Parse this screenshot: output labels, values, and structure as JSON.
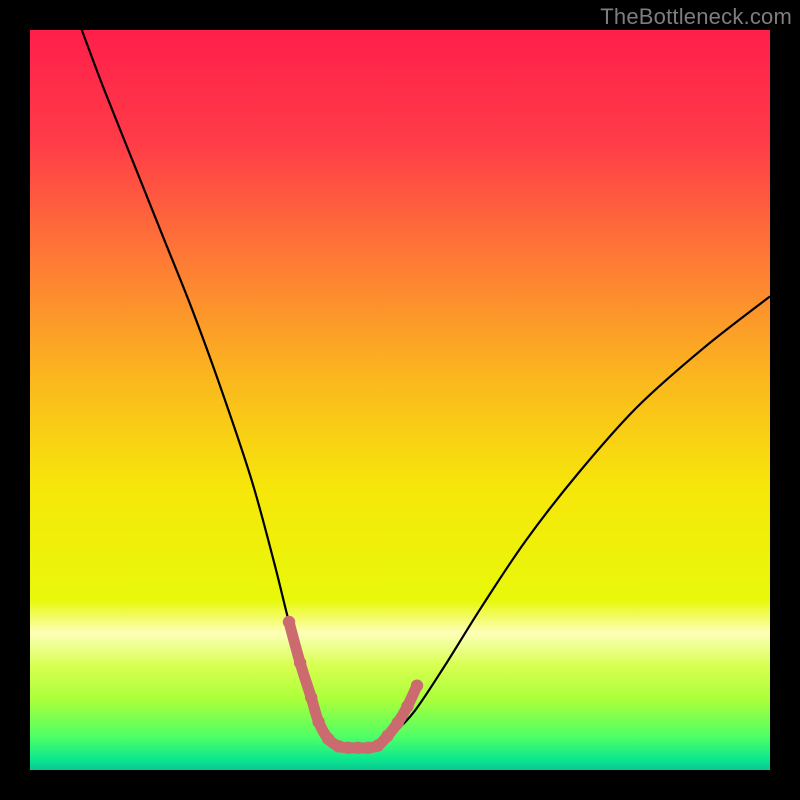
{
  "watermark": "TheBottleneck.com",
  "chart_data": {
    "type": "line",
    "title": "",
    "xlabel": "",
    "ylabel": "",
    "xlim": [
      0,
      100
    ],
    "ylim": [
      0,
      100
    ],
    "grid": false,
    "series": [
      {
        "name": "curve",
        "color": "#000000",
        "x": [
          7,
          10,
          14,
          18,
          22,
          26,
          30,
          33,
          35,
          37,
          38.5,
          40,
          41.5,
          43,
          45,
          47,
          49,
          52,
          56,
          61,
          67,
          74,
          82,
          91,
          100
        ],
        "y": [
          100,
          92,
          82,
          72,
          62,
          51,
          39,
          28,
          20,
          13,
          8,
          4.5,
          3,
          3,
          3,
          3.2,
          4.8,
          8,
          14,
          22,
          31,
          40,
          49,
          57,
          64
        ]
      },
      {
        "name": "highlight-bottom",
        "color": "#cb6a6f",
        "x": [
          35,
          36.5,
          38,
          39,
          40.3,
          41.7,
          43,
          44.3,
          45.7,
          47,
          48.3,
          49.7,
          51,
          52.3
        ],
        "y": [
          20,
          14.5,
          9.8,
          6.5,
          4.2,
          3.2,
          3,
          3,
          3,
          3.3,
          4.6,
          6.4,
          8.6,
          11.4
        ]
      }
    ],
    "background_gradient": {
      "type": "vertical",
      "stops": [
        {
          "offset": 0.0,
          "color": "#ff1f4a"
        },
        {
          "offset": 0.15,
          "color": "#ff3b48"
        },
        {
          "offset": 0.3,
          "color": "#fe7637"
        },
        {
          "offset": 0.47,
          "color": "#fbb71e"
        },
        {
          "offset": 0.62,
          "color": "#f6e70a"
        },
        {
          "offset": 0.77,
          "color": "#e8f80a"
        },
        {
          "offset": 0.815,
          "color": "#fdffb8"
        },
        {
          "offset": 0.86,
          "color": "#d7ff4f"
        },
        {
          "offset": 0.905,
          "color": "#aaff3a"
        },
        {
          "offset": 0.955,
          "color": "#4eff66"
        },
        {
          "offset": 0.985,
          "color": "#0de88e"
        },
        {
          "offset": 1.0,
          "color": "#07c893"
        }
      ]
    }
  }
}
